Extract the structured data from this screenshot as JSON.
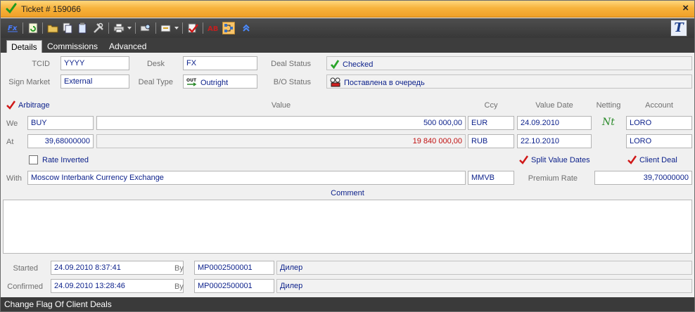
{
  "window": {
    "title": "Ticket # 159066",
    "close_glyph": "×"
  },
  "toolbar": {
    "icons": [
      "fx-icon",
      "refresh-icon",
      "open-folder-icon",
      "copy-icon",
      "paste-icon",
      "tools-icon",
      "print-icon",
      "print-preview-icon",
      "stamp-icon",
      "verify-icon",
      "font-icon",
      "flow-icon",
      "arrows-icon"
    ],
    "logo_label": "T"
  },
  "tabs": [
    "Details",
    "Commissions",
    "Advanced"
  ],
  "header": {
    "tcid_label": "TCID",
    "tcid_value": "YYYY",
    "desk_label": "Desk",
    "desk_value": "FX",
    "deal_status_label": "Deal Status",
    "deal_status_value": "Checked",
    "sign_market_label": "Sign Market",
    "sign_market_value": "External",
    "deal_type_label": "Deal Type",
    "deal_type_value": "Outright",
    "bo_status_label": "B/O Status",
    "bo_status_value": "Поставлена в очередь"
  },
  "deal": {
    "arbitrage_label": "Arbitrage",
    "col_value": "Value",
    "col_ccy": "Ccy",
    "col_value_date": "Value Date",
    "col_netting": "Netting",
    "col_account": "Account",
    "we_label": "We",
    "we_side": "BUY",
    "we_value": "500 000,00",
    "we_ccy": "EUR",
    "we_date": "24.09.2010",
    "we_netting": "Nt",
    "we_account": "LORO",
    "at_label": "At",
    "at_rate": "39,68000000",
    "at_value": "19 840 000,00",
    "at_ccy": "RUB",
    "at_date": "22.10.2010",
    "at_account": "LORO",
    "rate_inverted_label": "Rate Inverted",
    "split_value_dates_label": "Split Value Dates",
    "client_deal_label": "Client Deal",
    "with_label": "With",
    "with_value": "Moscow Interbank Currency Exchange",
    "with_code": "MMVB",
    "premium_rate_label": "Premium Rate",
    "premium_rate_value": "39,70000000"
  },
  "comment": {
    "label": "Comment",
    "value": ""
  },
  "audit": {
    "started_label": "Started",
    "started_value": "24.09.2010 8:37:41",
    "started_by_label": "By",
    "started_by_value": "MP0002500001",
    "started_role": "Дилер",
    "confirmed_label": "Confirmed",
    "confirmed_value": "24.09.2010 13:28:46",
    "confirmed_by_label": "By",
    "confirmed_by_value": "MP0002500001",
    "confirmed_role": "Дилер"
  },
  "status_bar": {
    "text": "Change Flag Of Client Deals"
  },
  "colors": {
    "title_bar": "#f7b33c",
    "toolbar": "#3d3d3d",
    "field_text": "#0a1f8a",
    "negative_value": "#c01010",
    "check": "#2aa52a",
    "red_check": "#d01818"
  }
}
